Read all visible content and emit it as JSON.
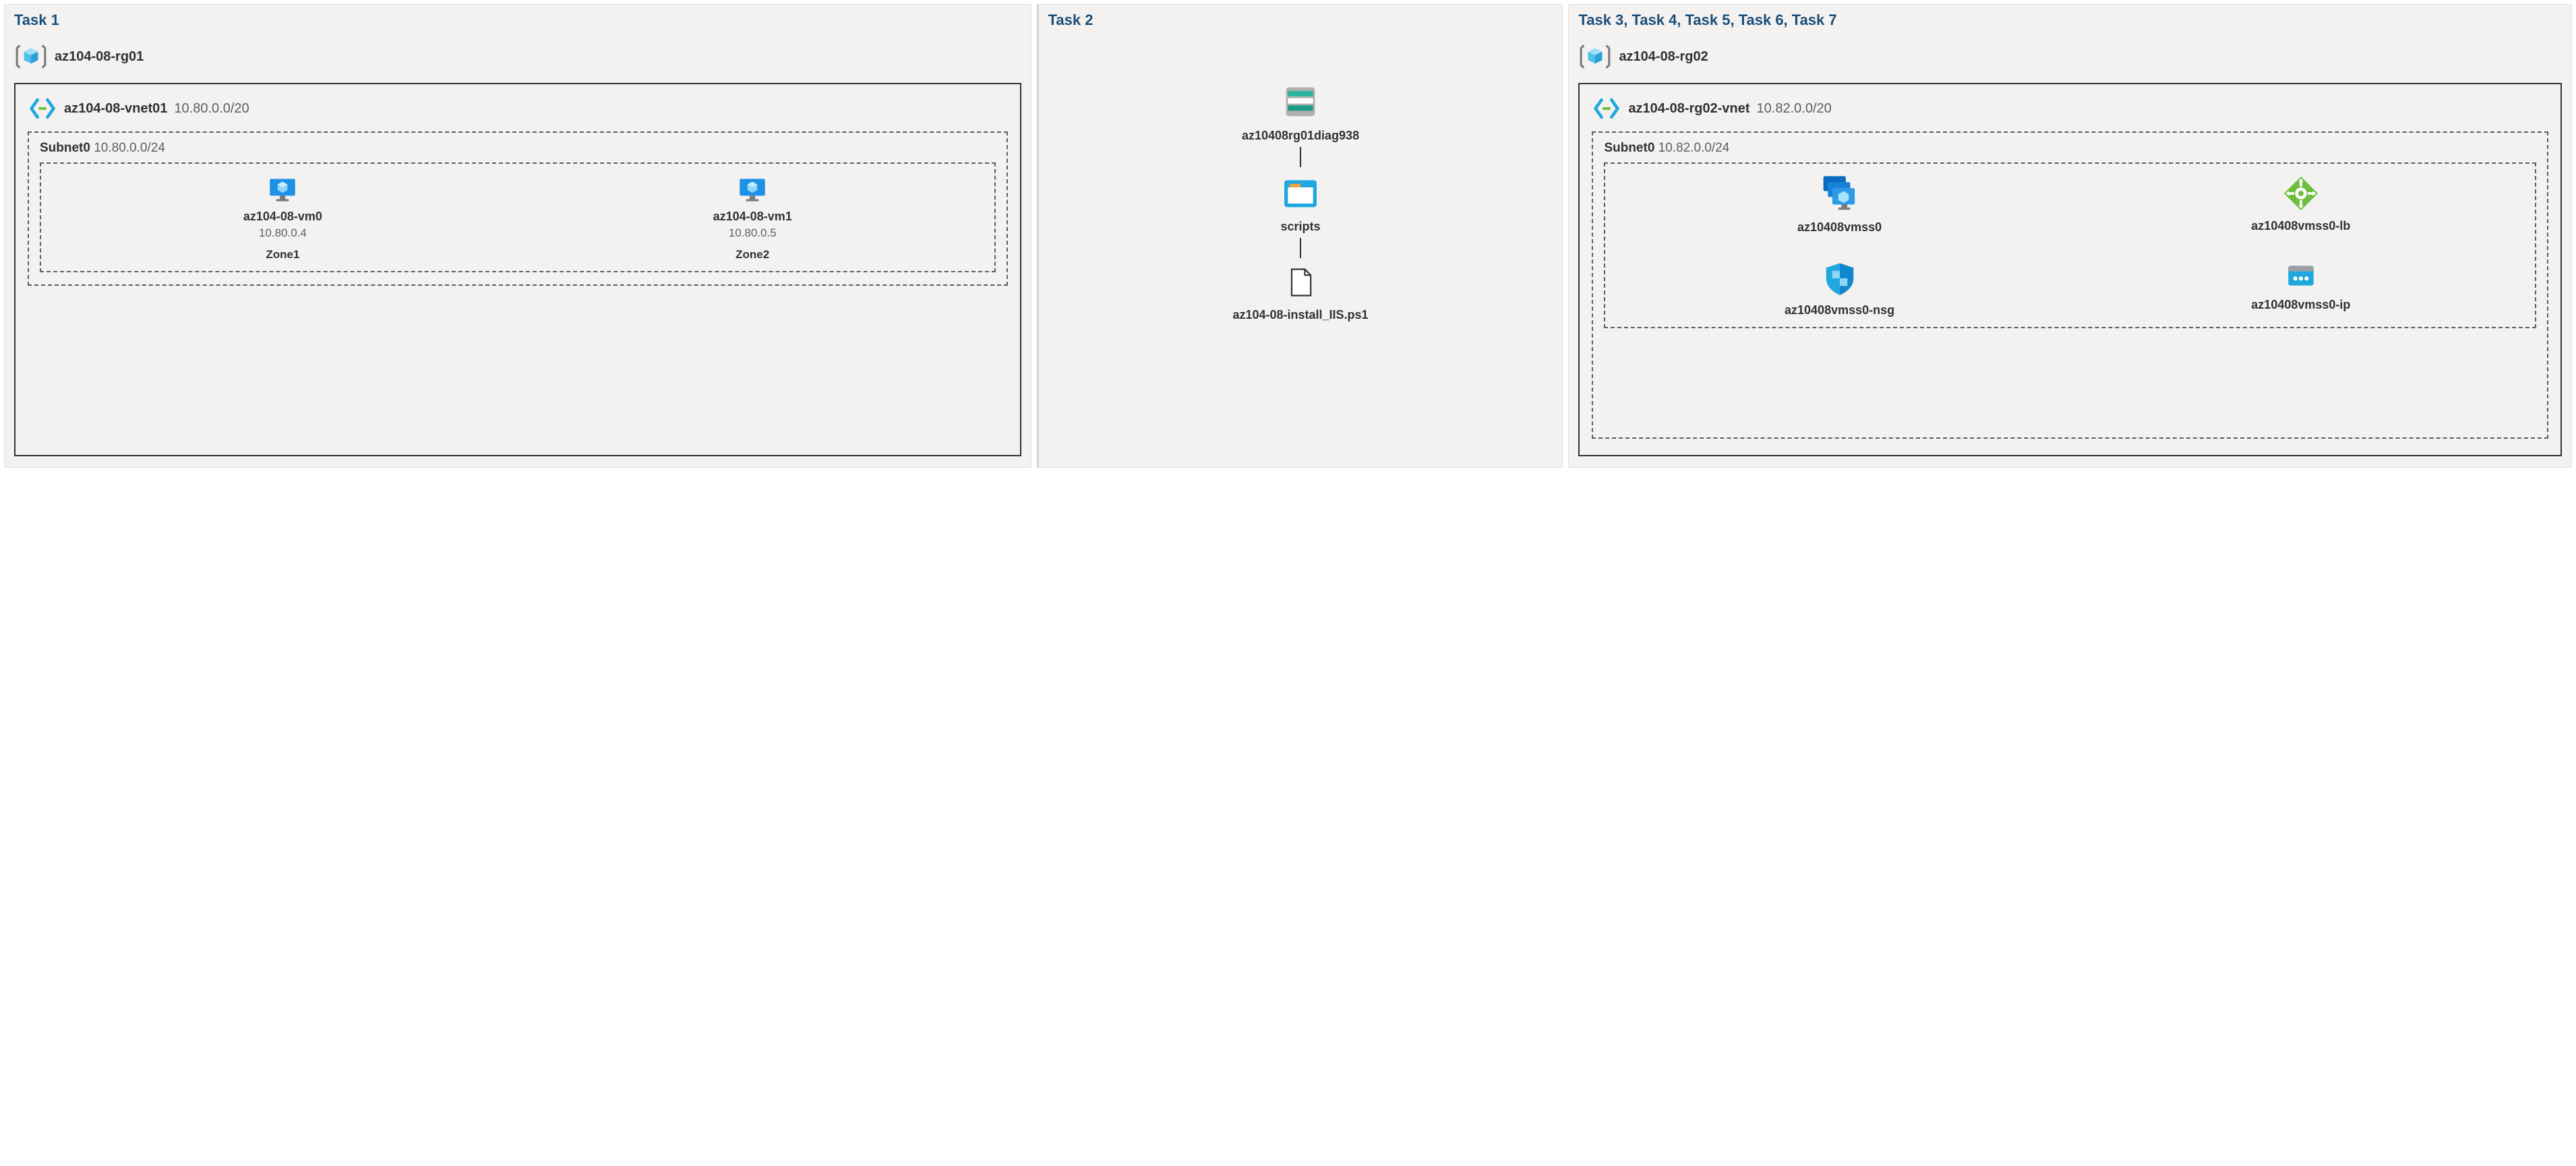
{
  "task1": {
    "title": "Task 1",
    "rg": "az104-08-rg01",
    "vnet": {
      "name": "az104-08-vnet01",
      "cidr": "10.80.0.0/20"
    },
    "subnet": {
      "name": "Subnet0",
      "cidr": "10.80.0.0/24"
    },
    "vms": [
      {
        "name": "az104-08-vm0",
        "ip": "10.80.0.4",
        "zone": "Zone1"
      },
      {
        "name": "az104-08-vm1",
        "ip": "10.80.0.5",
        "zone": "Zone2"
      }
    ]
  },
  "task2": {
    "title": "Task 2",
    "storage": "az10408rg01diag938",
    "container": "scripts",
    "file": "az104-08-install_IIS.ps1"
  },
  "task3": {
    "title": "Task 3, Task 4, Task 5, Task 6, Task 7",
    "rg": "az104-08-rg02",
    "vnet": {
      "name": "az104-08-rg02-vnet",
      "cidr": "10.82.0.0/20"
    },
    "subnet": {
      "name": "Subnet0",
      "cidr": "10.82.0.0/24"
    },
    "resources": {
      "vmss": "az10408vmss0",
      "lb": "az10408vmss0-lb",
      "nsg": "az10408vmss0-nsg",
      "ip": "az10408vmss0-ip"
    }
  }
}
